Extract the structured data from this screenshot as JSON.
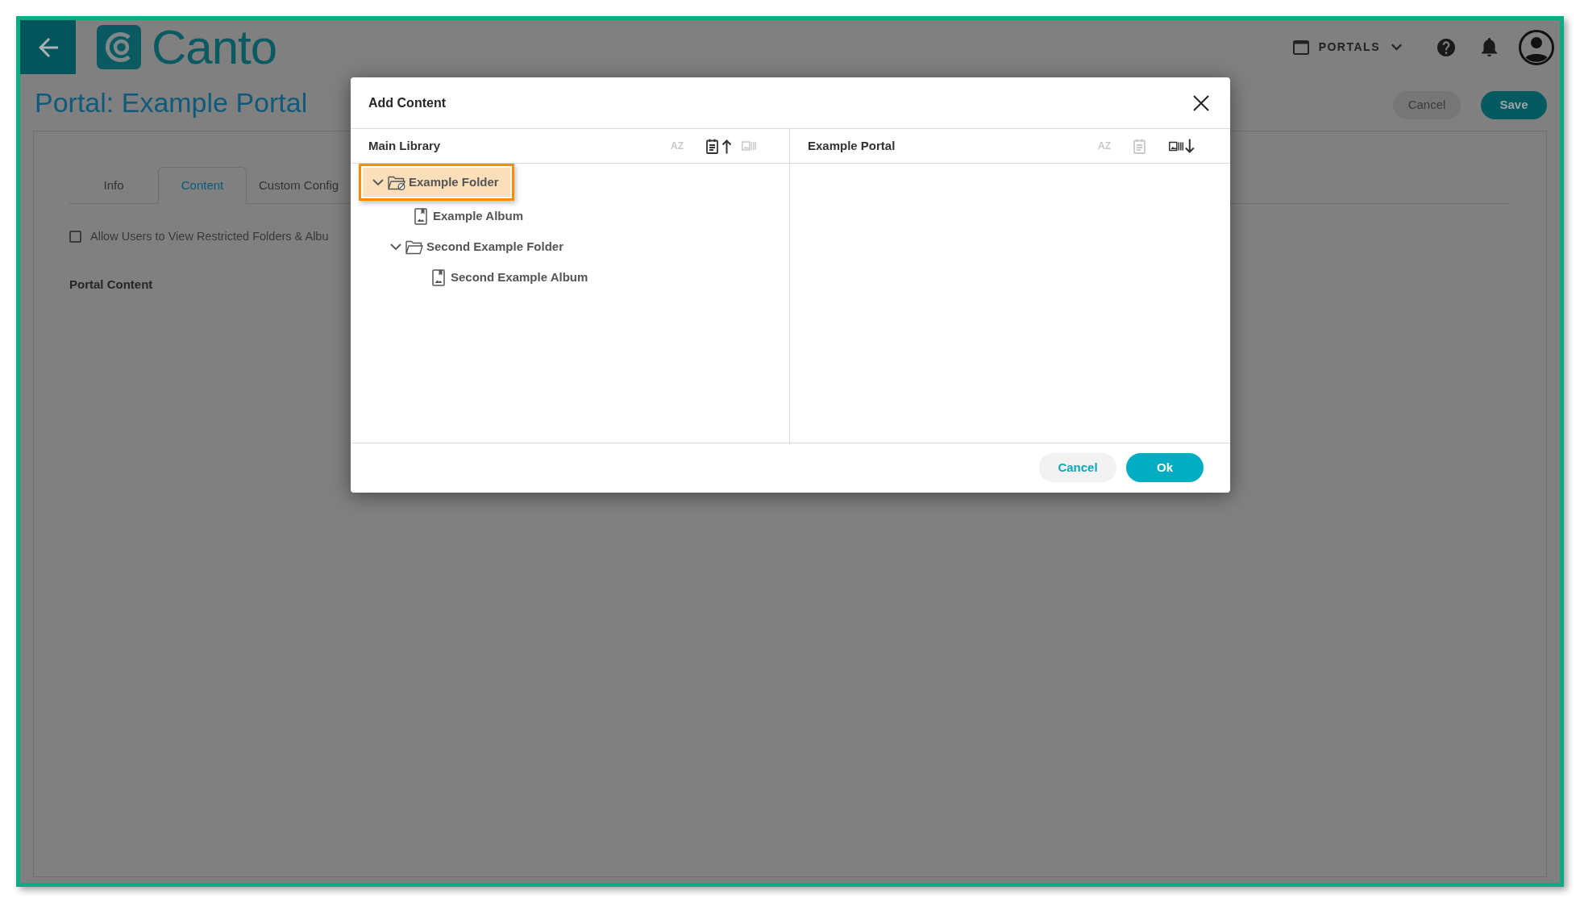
{
  "header": {
    "logo_text": "Canto",
    "portals_menu": "PORTALS"
  },
  "page": {
    "title": "Portal: Example Portal",
    "buttons": [
      {
        "label": "Cancel",
        "kind": "secondary"
      },
      {
        "label": "Save",
        "kind": "primary"
      }
    ]
  },
  "tabs": [
    {
      "label": "Info",
      "selected": false
    },
    {
      "label": "Content",
      "selected": true
    },
    {
      "label": "Custom Config",
      "selected": false
    }
  ],
  "restricted_option": {
    "label": "Allow Users to View Restricted Folders & Albu",
    "checked": false
  },
  "section_title": "Portal Content",
  "dialog": {
    "title": "Add Content",
    "panels": [
      {
        "title": "Main Library",
        "tools": [
          {
            "kind": "name",
            "label": "AZ",
            "active": false
          },
          {
            "kind": "date",
            "active": true,
            "ascending": true
          },
          {
            "kind": "type",
            "active": false
          }
        ],
        "tree": [
          {
            "label": "Example Folder",
            "kind": "folder",
            "selected": true,
            "expanded": true,
            "restricted": true,
            "children": [
              {
                "label": "Example Album",
                "kind": "album",
                "selected": false,
                "restricted": false
              },
              {
                "label": "Second Example Folder",
                "kind": "folder",
                "selected": false,
                "expanded": true,
                "restricted": false,
                "children": [
                  {
                    "label": "Second Example Album",
                    "kind": "album",
                    "selected": false,
                    "restricted": false
                  }
                ]
              }
            ]
          }
        ]
      },
      {
        "title": "Example Portal",
        "tools": [
          {
            "kind": "name",
            "label": "AZ",
            "active": false
          },
          {
            "kind": "date",
            "active": false
          },
          {
            "kind": "type",
            "active": true,
            "ascending": false
          }
        ]
      }
    ],
    "buttons": [
      {
        "label": "Cancel",
        "kind": "secondary"
      },
      {
        "label": "Ok",
        "kind": "primary"
      }
    ]
  }
}
